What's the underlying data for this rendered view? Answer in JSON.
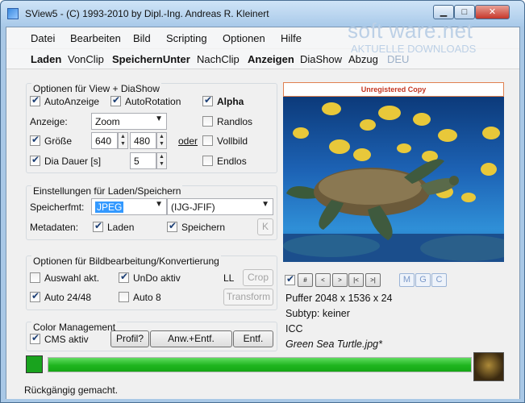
{
  "window": {
    "title": "SView5 - (C) 1993-2010 by Dipl.-Ing. Andreas R. Kleinert",
    "controls": {
      "minimize": "▁",
      "maximize": "□",
      "close": "✕"
    }
  },
  "watermark": {
    "brand": "soft ware.net",
    "tagline": "AKTUELLE DOWNLOADS"
  },
  "menu": [
    "Datei",
    "Bearbeiten",
    "Bild",
    "Scripting",
    "Optionen",
    "Hilfe"
  ],
  "toolbar": {
    "laden": "Laden",
    "vonclip": "VonClip",
    "speichernunter": "SpeichernUnter",
    "nachclip": "NachClip",
    "anzeigen": "Anzeigen",
    "diashow": "DiaShow",
    "abzug": "Abzug",
    "deu": "DEU"
  },
  "view_options": {
    "legend": "Optionen für View + DiaShow",
    "autoanzeige": "AutoAnzeige",
    "autorotation": "AutoRotation",
    "anzeige_label": "Anzeige:",
    "anzeige_value": "Zoom",
    "groesse": "Größe",
    "width": "640",
    "height": "480",
    "oder": "oder",
    "dia_dauer": "Dia Dauer [s]",
    "dia_value": "5",
    "alpha": "Alpha",
    "randlos": "Randlos",
    "vollbild": "Vollbild",
    "endlos": "Endlos"
  },
  "load_save": {
    "legend": "Einstellungen für Laden/Speichern",
    "format_label": "Speicherfmt:",
    "format_value": "JPEG",
    "format_sub": "(IJG-JFIF)",
    "meta_label": "Metadaten:",
    "laden": "Laden",
    "speichern": "Speichern",
    "k": "K"
  },
  "edit_options": {
    "legend": "Optionen für Bildbearbeitung/Konvertierung",
    "auswahl": "Auswahl akt.",
    "undo": "UnDo aktiv",
    "ll": "LL",
    "crop": "Crop",
    "auto2448": "Auto 24/48",
    "auto8": "Auto 8",
    "transform": "Transform"
  },
  "color_mgmt": {
    "legend": "Color Management",
    "cms": "CMS aktiv",
    "profil": "Profil?",
    "anw": "Anw.+Entf.",
    "entf": "Entf."
  },
  "preview": {
    "unregistered": "Unregistered Copy"
  },
  "nav": {
    "hash": "#",
    "prev": "<",
    "next": ">",
    "first": "|<",
    "last": ">|",
    "m": "M",
    "g": "G",
    "c": "C"
  },
  "image_info": {
    "buffer": "Puffer 2048 x 1536 x 24",
    "subtyp": "Subtyp: keiner",
    "icc": "ICC",
    "filename": "Green Sea Turtle.jpg*"
  },
  "progress": {
    "fraction": 1.0
  },
  "status": {
    "text": "Rückgängig gemacht."
  }
}
